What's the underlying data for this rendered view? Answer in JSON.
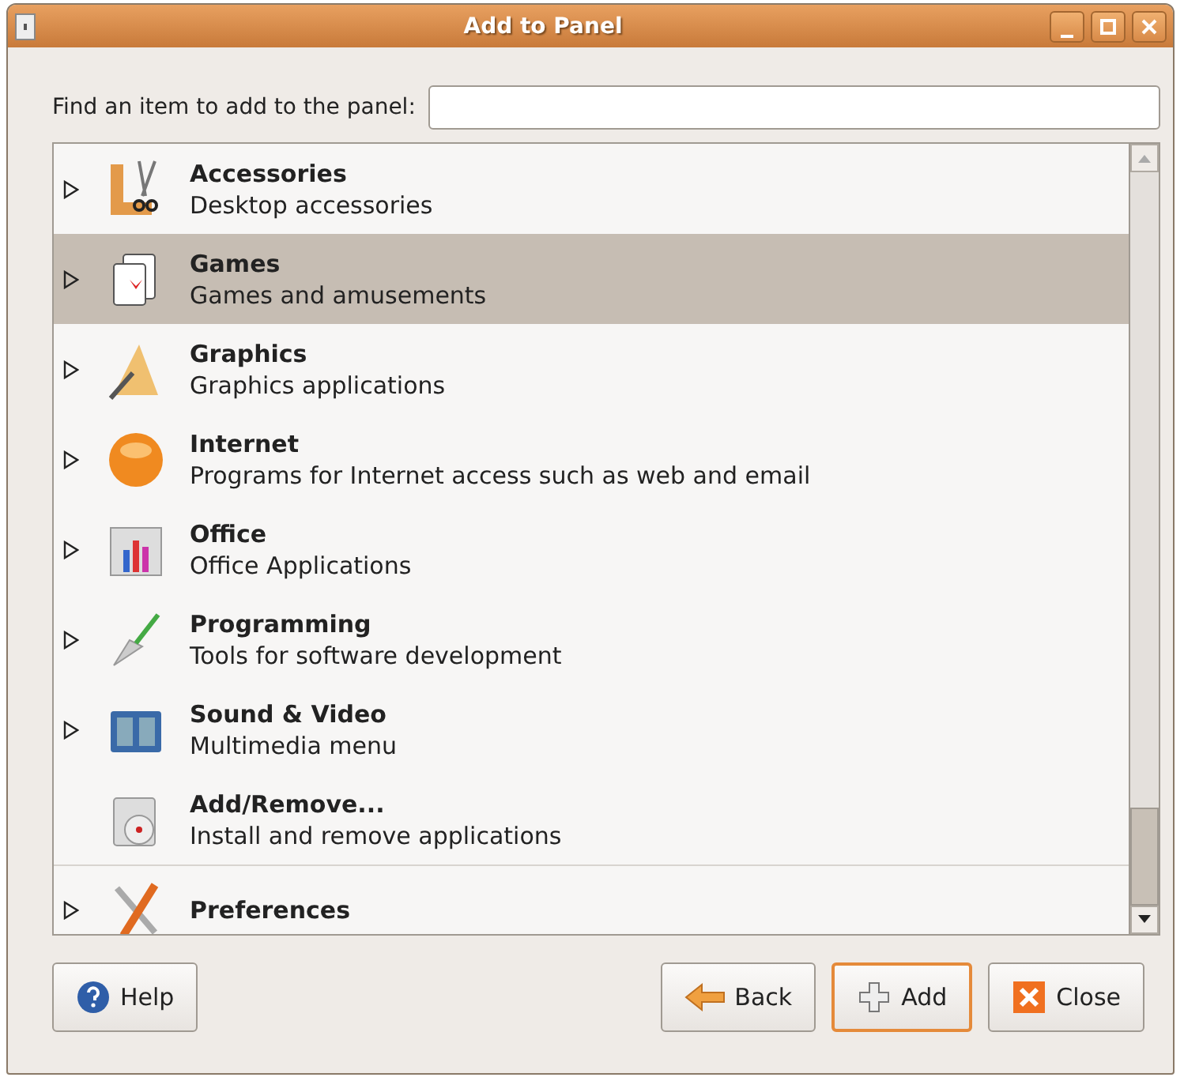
{
  "window": {
    "title": "Add to Panel"
  },
  "search": {
    "label": "Find an item to add to the panel:"
  },
  "items": [
    {
      "title": "Accessories",
      "subtitle": "Desktop accessories",
      "expandable": true,
      "selected": false
    },
    {
      "title": "Games",
      "subtitle": "Games and amusements",
      "expandable": true,
      "selected": true
    },
    {
      "title": "Graphics",
      "subtitle": "Graphics applications",
      "expandable": true,
      "selected": false
    },
    {
      "title": "Internet",
      "subtitle": "Programs for Internet access such as web and email",
      "expandable": true,
      "selected": false
    },
    {
      "title": "Office",
      "subtitle": "Office Applications",
      "expandable": true,
      "selected": false
    },
    {
      "title": "Programming",
      "subtitle": "Tools for software development",
      "expandable": true,
      "selected": false
    },
    {
      "title": "Sound & Video",
      "subtitle": "Multimedia menu",
      "expandable": true,
      "selected": false
    },
    {
      "title": "Add/Remove...",
      "subtitle": "Install and remove applications",
      "expandable": false,
      "selected": false
    },
    {
      "title": "Preferences",
      "expandable": true,
      "selected": false
    }
  ],
  "buttons": [
    {
      "kind": "help",
      "label": "Help"
    },
    {
      "kind": "back",
      "label": "Back"
    },
    {
      "kind": "add",
      "label": "Add",
      "default": true
    },
    {
      "kind": "close",
      "label": "Close"
    }
  ]
}
